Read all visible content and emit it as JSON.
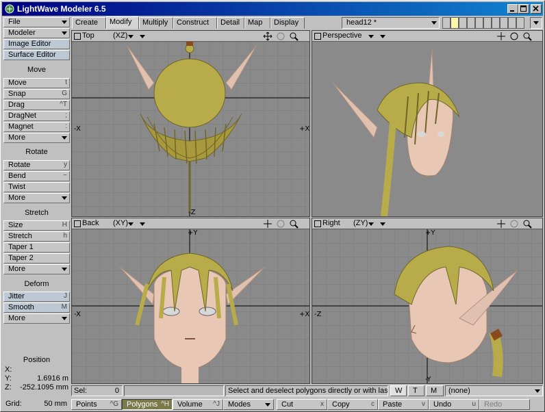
{
  "window": {
    "title": "LightWave Modeler 6.5"
  },
  "sidebar": {
    "file": "File",
    "modeler": "Modeler",
    "image_editor": "Image Editor",
    "surface_editor": "Surface Editor",
    "move_header": "Move",
    "move": {
      "label": "Move",
      "key": "t"
    },
    "snap": {
      "label": "Snap",
      "key": "G"
    },
    "drag": {
      "label": "Drag",
      "key": "^T"
    },
    "dragnet": {
      "label": "DragNet",
      "key": ";"
    },
    "magnet": {
      "label": "Magnet",
      "key": ":"
    },
    "more1": "More",
    "rotate_header": "Rotate",
    "rotate": {
      "label": "Rotate",
      "key": "y"
    },
    "bend": {
      "label": "Bend",
      "key": "~"
    },
    "twist": {
      "label": "Twist",
      "key": ""
    },
    "more2": "More",
    "stretch_header": "Stretch",
    "size": {
      "label": "Size",
      "key": "H"
    },
    "stretch": {
      "label": "Stretch",
      "key": "h"
    },
    "taper1": {
      "label": "Taper 1",
      "key": ""
    },
    "taper2": {
      "label": "Taper 2",
      "key": ""
    },
    "more3": "More",
    "deform_header": "Deform",
    "jitter": {
      "label": "Jitter",
      "key": "J"
    },
    "smooth": {
      "label": "Smooth",
      "key": "M"
    },
    "more4": "More"
  },
  "position": {
    "title": "Position",
    "x_label": "X:",
    "x": "",
    "y_label": "Y:",
    "y": "1.6916 m",
    "z_label": "Z:",
    "z": "-252.1095 mm"
  },
  "grid": {
    "label": "Grid:",
    "value": "50 mm"
  },
  "tabs": [
    "Create",
    "Modify",
    "Multiply",
    "Construct",
    "Detail",
    "Map",
    "Display"
  ],
  "active_tab": "Modify",
  "object_select": "head12 *",
  "viewports": {
    "top": {
      "name": "Top",
      "axes": "(XZ)",
      "neg": "-X",
      "pos": "+X",
      "bottom": "-Z"
    },
    "perspective": {
      "name": "Perspective"
    },
    "back": {
      "name": "Back",
      "axes": "(XY)",
      "neg": "-X",
      "pos": "+X",
      "top": "+Y"
    },
    "right": {
      "name": "Right",
      "axes": "(ZY)",
      "neg": "-Z",
      "top": "+Y",
      "bottom": "-Y"
    }
  },
  "status": {
    "sel_label": "Sel:",
    "sel_value": "0",
    "message": "Select and deselect polygons directly or with las...",
    "w": "W",
    "t": "T",
    "m": "M",
    "surface": "(none)"
  },
  "bottom": {
    "points": {
      "label": "Points",
      "key": "^G"
    },
    "polygons": {
      "label": "Polygons",
      "key": "^H"
    },
    "volume": {
      "label": "Volume",
      "key": "^J"
    },
    "modes": "Modes",
    "cut": {
      "label": "Cut",
      "key": "x"
    },
    "copy": {
      "label": "Copy",
      "key": "c"
    },
    "paste": {
      "label": "Paste",
      "key": "v"
    },
    "undo": {
      "label": "Undo",
      "key": "u"
    },
    "redo": {
      "label": "Redo",
      "key": ""
    }
  },
  "colors": {
    "title_start": "#000080",
    "title_end": "#1084d0",
    "viewport_bg": "#8a8a8a",
    "hair": "#b8ab4a",
    "skin": "#e8c8b4",
    "active_mode": "#7a7a4a"
  }
}
